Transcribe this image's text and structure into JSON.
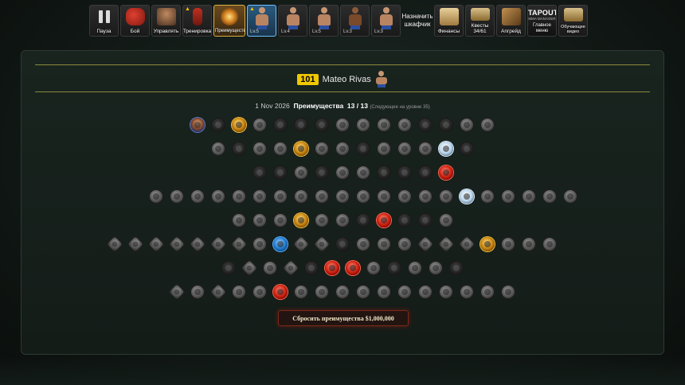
{
  "toolbar": {
    "items": [
      {
        "label": "Пауза",
        "icon": "pause-icon",
        "warning": false
      },
      {
        "label": "Бой",
        "icon": "gloves-icon",
        "warning": false
      },
      {
        "label": "Управлять",
        "icon": "manager-icon",
        "warning": false
      },
      {
        "label": "Тренировка",
        "icon": "punching-bag-icon",
        "warning": true
      },
      {
        "label": "Преимущества",
        "icon": "perk-burst-icon",
        "warning": false
      }
    ],
    "fighters": [
      {
        "level": "Lv.5",
        "warning": true,
        "selected": true
      },
      {
        "level": "Lv.4",
        "warning": false,
        "selected": false
      },
      {
        "level": "Lv.5",
        "warning": false,
        "selected": false
      },
      {
        "level": "Lv.3",
        "warning": false,
        "selected": false
      },
      {
        "level": "Lv.3",
        "warning": false,
        "selected": false
      }
    ],
    "assign_locker": "Назначить шкафчик",
    "finance": "Финансы",
    "quests": "Квесты 34/61",
    "upgrade": "Апгрейд",
    "tapout_logo": "TAPOUT",
    "tapout_sub": "MMA MANAGER",
    "main_menu": "Главное меню",
    "tutorial": "Обучающее видео"
  },
  "fighter": {
    "level": "101",
    "name": "Mateo Rivas"
  },
  "perks": {
    "date": "1 Nov 2026",
    "label": "Преимущества",
    "current": "13",
    "separator": "/",
    "total": "13",
    "next_note": "(Следующее на уровне 35)"
  },
  "reset_button": {
    "label": "Сбросить преимущества $1,000,000"
  },
  "colors": {
    "accent_gold": "#f0c800",
    "reset_border": "#7a2a1a",
    "selected_fighter": "#6ec0ff"
  }
}
